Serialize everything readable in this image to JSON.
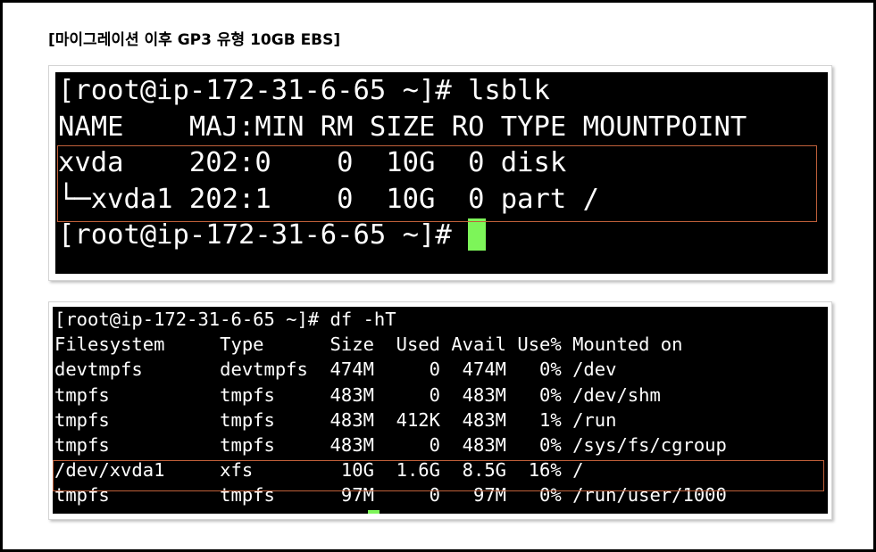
{
  "heading": "[마이그레이션 이후 GP3 유형 10GB EBS]",
  "terminal_lsblk": {
    "lines": [
      "[root@ip-172-31-6-65 ~]# lsblk",
      "NAME    MAJ:MIN RM SIZE RO TYPE MOUNTPOINT",
      "xvda    202:0    0  10G  0 disk",
      "└─xvda1 202:1    0  10G  0 part /"
    ],
    "prompt": "[root@ip-172-31-6-65 ~]# "
  },
  "terminal_df": {
    "lines": [
      "[root@ip-172-31-6-65 ~]# df -hT",
      "Filesystem     Type      Size  Used Avail Use% Mounted on",
      "devtmpfs       devtmpfs  474M     0  474M   0% /dev",
      "tmpfs          tmpfs     483M     0  483M   0% /dev/shm",
      "tmpfs          tmpfs     483M  412K  483M   1% /run",
      "tmpfs          tmpfs     483M     0  483M   0% /sys/fs/cgroup",
      "/dev/xvda1     xfs        10G  1.6G  8.5G  16% /",
      "tmpfs          tmpfs      97M     0   97M   0% /run/user/1000"
    ]
  },
  "colors": {
    "terminal_bg": "#000000",
    "terminal_fg": "#ffffff",
    "cursor": "#7df559",
    "highlight_border": "#c0603a"
  }
}
